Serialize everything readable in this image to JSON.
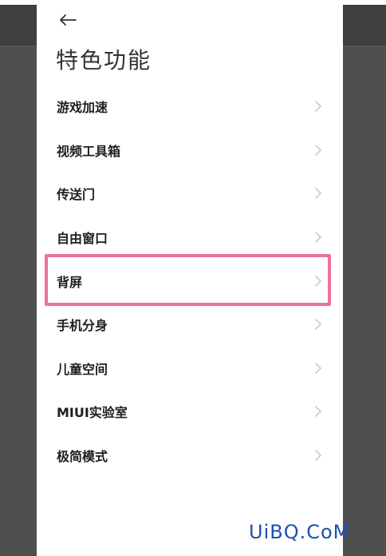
{
  "header": {
    "back_icon": "arrow-left-icon",
    "title": "特色功能"
  },
  "menu": {
    "items": [
      {
        "label": "游戏加速"
      },
      {
        "label": "视频工具箱"
      },
      {
        "label": "传送门"
      },
      {
        "label": "自由窗口"
      },
      {
        "label": "背屏"
      },
      {
        "label": "手机分身"
      },
      {
        "label": "儿童空间"
      },
      {
        "label": "MIUI实验室"
      },
      {
        "label": "极简模式"
      }
    ],
    "chevron_icon": "chevron-right-icon"
  },
  "highlight": {
    "color": "#ea7399"
  },
  "watermark": {
    "text": "UiBQ.CoM",
    "color": "#1f4fae"
  },
  "colors": {
    "side_panel": "#4f4f4f",
    "text": "#1f1f1f",
    "chevron": "#c4c4c4"
  }
}
